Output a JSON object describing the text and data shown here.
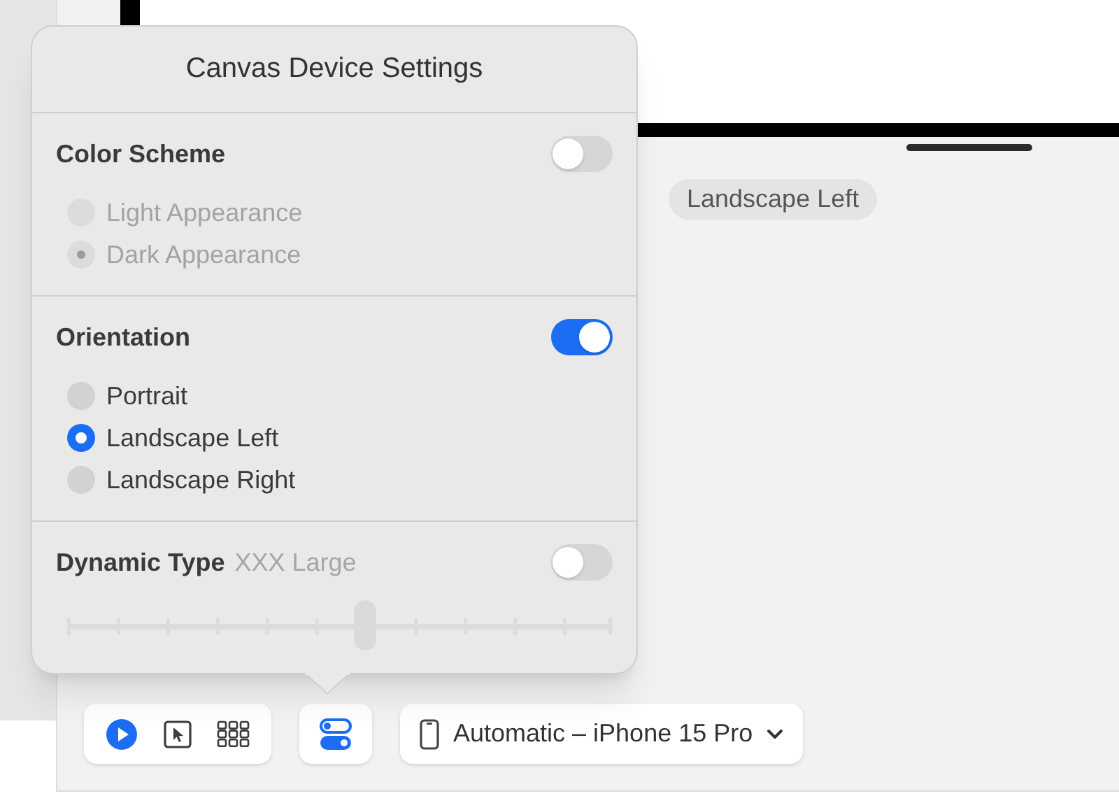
{
  "canvas": {
    "orientation_label": "Landscape Left"
  },
  "popover": {
    "title": "Canvas Device Settings",
    "sections": [
      {
        "kind": "radio",
        "title": "Color Scheme",
        "on": false,
        "options": [
          {
            "label": "Light Appearance",
            "selected": false
          },
          {
            "label": "Dark Appearance",
            "selected": true
          }
        ]
      },
      {
        "kind": "radio",
        "title": "Orientation",
        "on": true,
        "options": [
          {
            "label": "Portrait",
            "selected": false
          },
          {
            "label": "Landscape Left",
            "selected": true
          },
          {
            "label": "Landscape Right",
            "selected": false
          }
        ]
      },
      {
        "kind": "slider",
        "title": "Dynamic Type",
        "value": "XXX Large",
        "on": false,
        "level": 0.545
      }
    ]
  },
  "toolbar": {
    "modes": [
      {
        "kind": "live",
        "selected": true
      },
      {
        "kind": "select",
        "selected": false
      },
      {
        "kind": "variants",
        "selected": false
      }
    ],
    "settings_button": {
      "selected": true
    },
    "device": "Automatic – iPhone 15 Pro"
  }
}
